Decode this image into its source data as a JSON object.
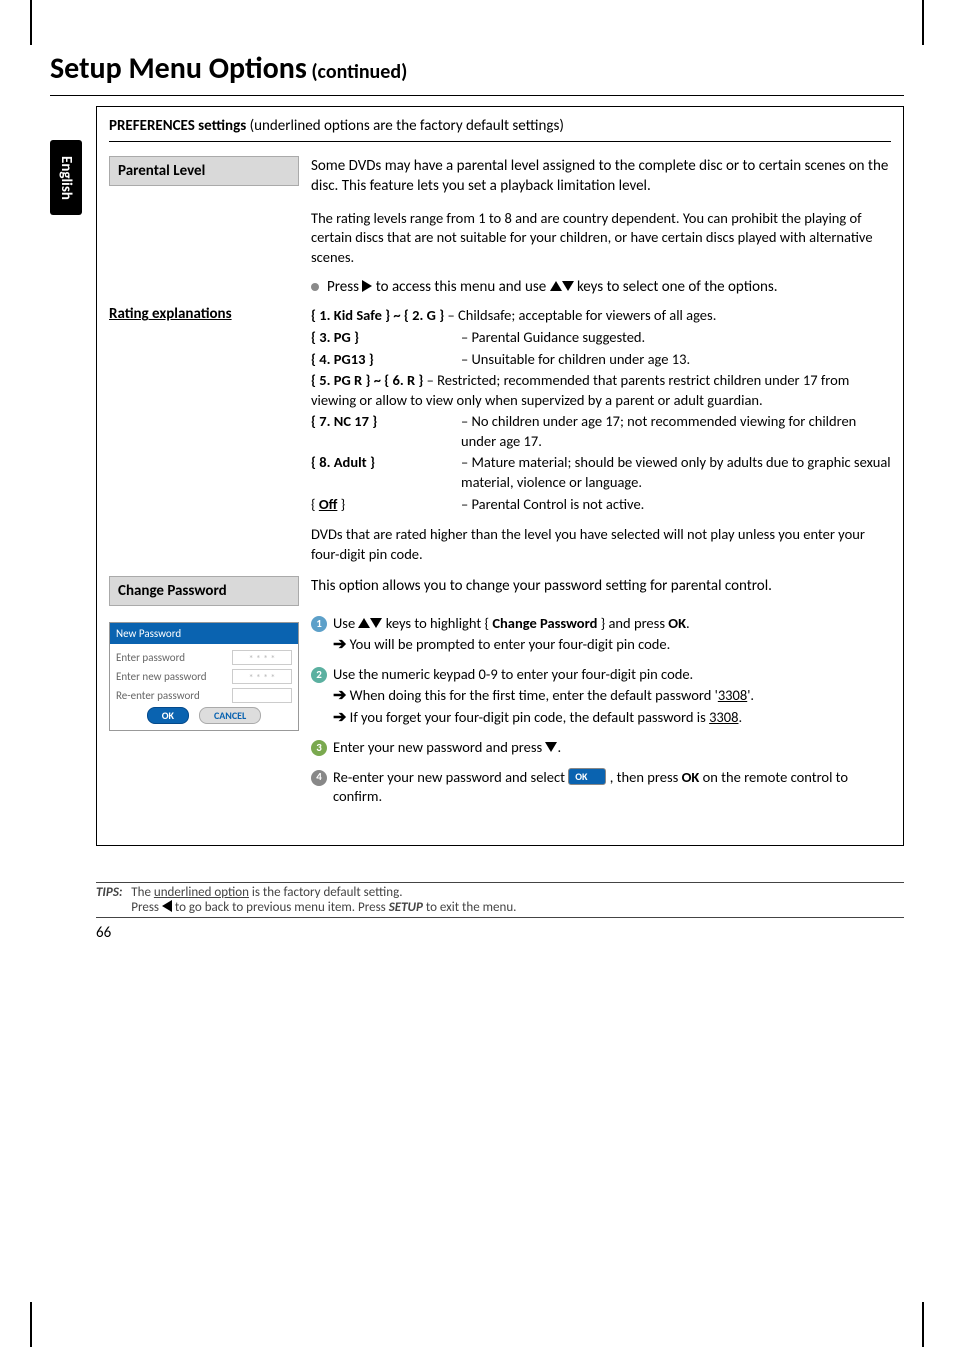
{
  "page_title_main": "Setup Menu Options",
  "page_title_cont": " (continued)",
  "side_tab": "English",
  "section_header_bold": "PREFERENCES settings",
  "section_header_rest": " (underlined options are the factory default settings)",
  "parental": {
    "label": "Parental Level",
    "intro": "Some DVDs may have a parental level assigned to the complete disc or to certain scenes on the disc. This feature lets you set a playback limitation level.",
    "note": "The rating levels range from 1 to 8 and are country dependent. You can prohibit the playing of certain discs that are not suitable for your children, or have certain discs played with alternative scenes.",
    "bullet_pre": "Press ",
    "bullet_mid": " to access this menu and use ",
    "bullet_post": " keys to select one of the options."
  },
  "rating_head": "Rating explanations",
  "ratings": {
    "r1_key": "{ 1. Kid Safe } ~ { 2. G }",
    "r1_val": " – Childsafe; acceptable for viewers of all ages.",
    "r3_key": "{ 3. PG }",
    "r3_val": "–  Parental Guidance suggested.",
    "r4_key": "{ 4. PG13 }",
    "r4_val": "–  Unsuitable for children under age 13.",
    "r5_key": "{ 5. PG R } ~ { 6. R }",
    "r5_val": " – Restricted; recommended that parents restrict children under 17 from viewing or allow to view only when supervized by a parent or adult guardian.",
    "r7_key": "{ 7. NC 17 }",
    "r7_val": "–  No children under age 17; not recommended viewing for children under age 17.",
    "r8_key": "{ 8. Adult }",
    "r8_val": "–  Mature material; should be viewed only by adults due to graphic sexual material, violence or language.",
    "roff_key": "{ Off }",
    "roff_val": "–  Parental Control is not active.",
    "footer": "DVDs that are rated higher than the level you have selected will not play unless you enter your four-digit pin code."
  },
  "change": {
    "label": "Change Password",
    "intro": "This option allows you to change your password setting for parental control."
  },
  "dialog": {
    "title": "New Password",
    "row1": "Enter password",
    "row2": "Enter new password",
    "row3": "Re-enter password",
    "stars": "* * * *",
    "ok": "OK",
    "cancel": "CANCEL"
  },
  "steps": {
    "s1a": "Use ",
    "s1b": " keys to highlight { ",
    "s1b2": "Change Password",
    "s1c": " } and press ",
    "s1c2": "OK",
    "s1d": ".",
    "s1sub": " You will be prompted to enter your four-digit pin code.",
    "s2a": "Use the numeric keypad 0-9 to enter your four-digit pin code.",
    "s2sub1": " When doing this for the first time, enter the default password '",
    "s2sub1b": "3308",
    "s2sub1c": "'.",
    "s2sub2": " If you forget your four-digit pin code, the default password is ",
    "s2sub2b": "3308",
    "s2sub2c": ".",
    "s3": "Enter your new password and press ",
    "s3b": ".",
    "s4a": "Re-enter your new password and select ",
    "s4b": " , then press ",
    "s4b2": "OK",
    "s4c": " on the remote control to confirm.",
    "ok_pill": "OK"
  },
  "tips": {
    "label": "TIPS:",
    "line1a": "The ",
    "line1b": "underlined option",
    "line1c": " is the factory default setting.",
    "line2a": "Press ",
    "line2b": " to go back to previous menu item. Press ",
    "line2c": "SETUP",
    "line2d": " to exit the menu."
  },
  "page_num": "66"
}
